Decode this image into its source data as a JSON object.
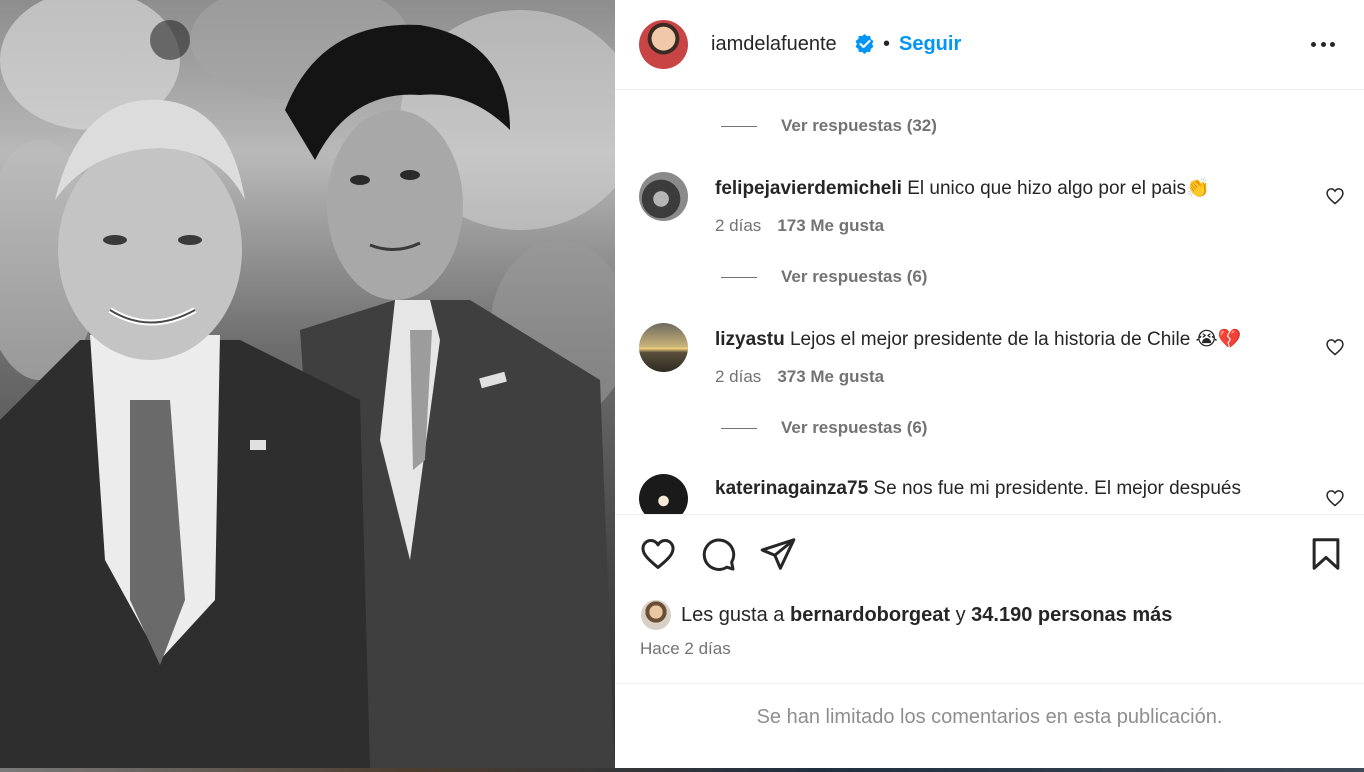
{
  "post": {
    "author": "iamdelafuente",
    "follow_label": "Seguir",
    "separator": "•",
    "verified": true
  },
  "comments": [
    {
      "replies_label": "Ver respuestas (32)"
    },
    {
      "username": "felipejavierdemicheli",
      "text": "El unico que hizo algo por el pais👏",
      "time": "2 días",
      "likes": "173 Me gusta",
      "replies_label": "Ver respuestas (6)"
    },
    {
      "username": "lizyastu",
      "text": "Lejos el mejor presidente de la historia de Chile 😭💔",
      "time": "2 días",
      "likes": "373 Me gusta",
      "replies_label": "Ver respuestas (6)"
    },
    {
      "username": "katerinagainza75",
      "text": "Se nos fue mi presidente. El mejor después"
    }
  ],
  "actions": {
    "like_icon": "heart-icon",
    "comment_icon": "comment-icon",
    "share_icon": "paper-plane-icon",
    "save_icon": "bookmark-icon"
  },
  "likes_summary": {
    "prefix": "Les gusta a",
    "user": "bernardoborgeat",
    "connector": "y",
    "others": "34.190 personas más"
  },
  "time_ago": "Hace 2 días",
  "comments_limited": "Se han limitado los comentarios en esta publicación.",
  "colors": {
    "accent": "#0095f6",
    "muted": "#737373",
    "text": "#262626",
    "verified": "#0095f6"
  }
}
